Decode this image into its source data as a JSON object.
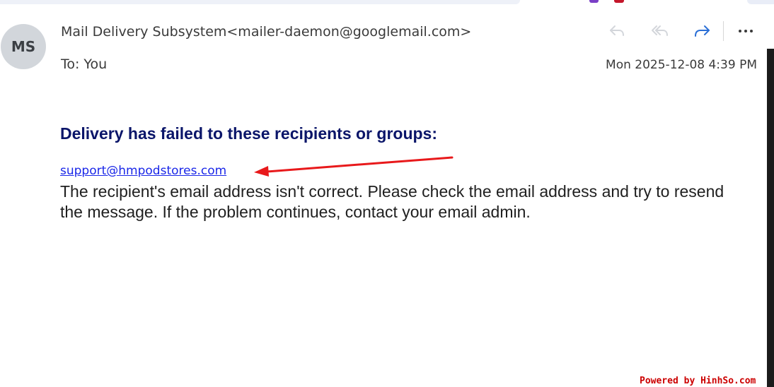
{
  "header": {
    "avatar_initials": "MS",
    "sender": "Mail Delivery Subsystem<mailer-daemon@googlemail.com>",
    "to_label": "To:",
    "to_value": "You",
    "date": "Mon 2025-12-08 4:39 PM"
  },
  "actions": {
    "reply_icon": "reply-icon",
    "reply_all_icon": "reply-all-icon",
    "forward_icon": "forward-icon",
    "more_icon": "more-horizontal-icon"
  },
  "body": {
    "headline": "Delivery has failed to these recipients or groups:",
    "recipient": "support@hmpodstores.com",
    "message": "The recipient's email address isn't correct. Please check the email address and try to resend the message. If the problem continues, contact your email admin."
  },
  "annotation": {
    "arrow_color": "#e8191b"
  },
  "watermark": "Powered by HinhSo.com",
  "colors": {
    "headline": "#0a1569",
    "link": "#1a27e8",
    "forward_icon": "#2b6fd6"
  }
}
